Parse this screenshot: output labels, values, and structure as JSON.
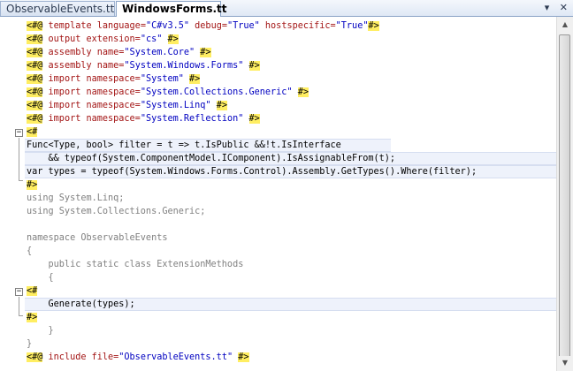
{
  "tabs": [
    {
      "label": "ObservableEvents.tt",
      "active": false
    },
    {
      "label": "WindowsForms.tt",
      "active": true
    }
  ],
  "tab_controls": {
    "dropdown": "▾",
    "close": "✕"
  },
  "code": {
    "l1": {
      "open": "<#@",
      "a": " template ",
      "b": "language=",
      "c": "\"C#v3.5\"",
      "d": " debug=",
      "e": "\"True\"",
      "f": " hostspecific=",
      "g": "\"True\"",
      "close": "#>"
    },
    "l2": {
      "open": "<#@",
      "a": " output ",
      "b": "extension=",
      "c": "\"cs\"",
      "close": "#>"
    },
    "l3": {
      "open": "<#@",
      "a": " assembly ",
      "b": "name=",
      "c": "\"System.Core\"",
      "close": "#>"
    },
    "l4": {
      "open": "<#@",
      "a": " assembly ",
      "b": "name=",
      "c": "\"System.Windows.Forms\"",
      "close": "#>"
    },
    "l5": {
      "open": "<#@",
      "a": " import ",
      "b": "namespace=",
      "c": "\"System\"",
      "close": "#>"
    },
    "l6": {
      "open": "<#@",
      "a": " import ",
      "b": "namespace=",
      "c": "\"System.Collections.Generic\"",
      "close": "#>"
    },
    "l7": {
      "open": "<#@",
      "a": " import ",
      "b": "namespace=",
      "c": "\"System.Linq\"",
      "close": "#>"
    },
    "l8": {
      "open": "<#@",
      "a": " import ",
      "b": "namespace=",
      "c": "\"System.Reflection\"",
      "close": "#>"
    },
    "l9": {
      "open": "<#"
    },
    "l10": {
      "text": "Func<Type, bool> filter = t => t.IsPublic &&!t.IsInterface"
    },
    "l11": {
      "text": "    && typeof(System.ComponentModel.IComponent).IsAssignableFrom(t);"
    },
    "l12": {
      "text": "var types = typeof(System.Windows.Forms.Control).Assembly.GetTypes().Where(filter);"
    },
    "l13": {
      "close": "#>"
    },
    "l14": {
      "text": "using System.Linq;"
    },
    "l15": {
      "text": "using System.Collections.Generic;"
    },
    "l17": {
      "text": "namespace ObservableEvents"
    },
    "l18": {
      "text": "{"
    },
    "l19": {
      "text": "    public static class ExtensionMethods"
    },
    "l20": {
      "text": "    {"
    },
    "l21": {
      "open": "<#"
    },
    "l22": {
      "text": "    Generate(types);"
    },
    "l23": {
      "close": "#>"
    },
    "l24": {
      "text": "    }"
    },
    "l25": {
      "text": "}"
    },
    "l26": {
      "open": "<#@",
      "a": " include ",
      "b": "file=",
      "c": "\"ObservableEvents.tt\"",
      "close": "#>"
    }
  },
  "scrollbar": {
    "up": "▲",
    "down": "▼"
  }
}
